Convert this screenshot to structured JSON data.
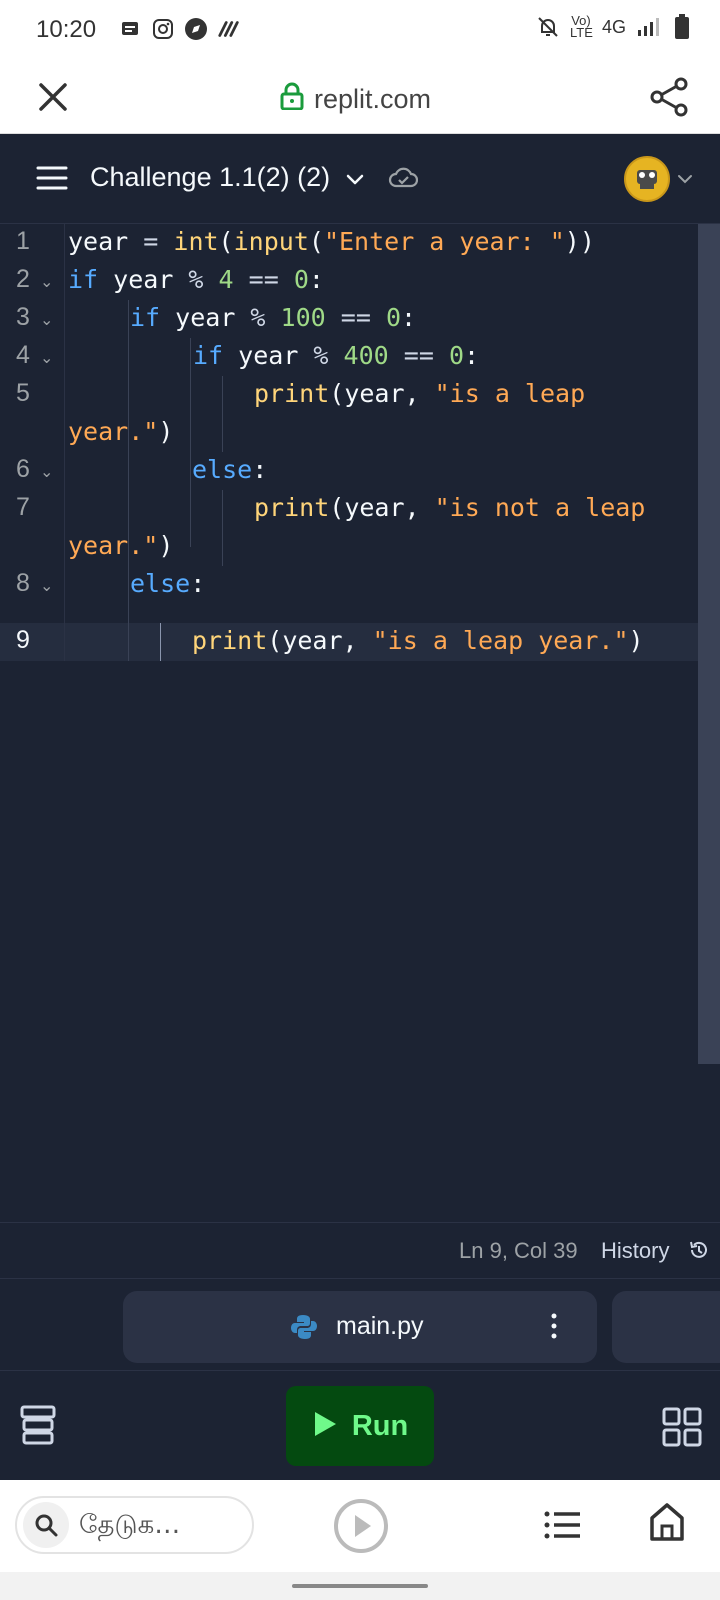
{
  "status_bar": {
    "time": "10:20",
    "network_label": "4G",
    "volte_label": "Vo) LTE"
  },
  "browser": {
    "url": "replit.com",
    "search_placeholder": "தேடுக…"
  },
  "header": {
    "project_title": "Challenge 1.1(2) (2)"
  },
  "editor": {
    "line_numbers": [
      "1",
      "2",
      "3",
      "4",
      "5",
      "6",
      "7",
      "8",
      "9"
    ]
  },
  "status_line": {
    "cursor_position": "Ln 9, Col 39",
    "history_label": "History"
  },
  "tabs": {
    "active_file": "main.py"
  },
  "toolbar": {
    "run_label": "Run"
  },
  "colors": {
    "background": "#1c2333",
    "keyword": "#57abff",
    "function": "#ffd57a",
    "string": "#ffa955",
    "number": "#9fd987",
    "run_button_bg": "#044a10",
    "run_button_text": "#6ff98a"
  }
}
